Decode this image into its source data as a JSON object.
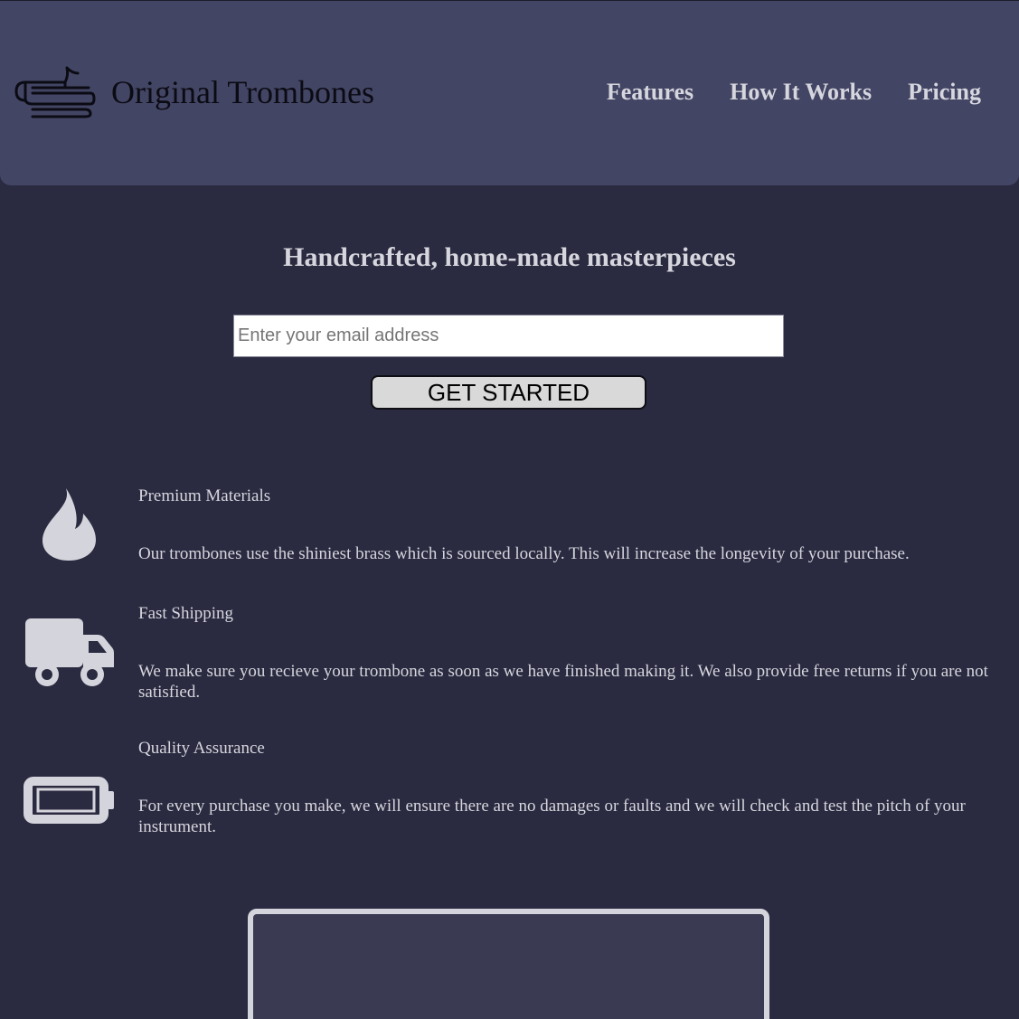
{
  "header": {
    "brand": "Original Trombones",
    "logo_icon": "trombone-icon",
    "nav": [
      {
        "label": "Features"
      },
      {
        "label": "How It Works"
      },
      {
        "label": "Pricing"
      }
    ]
  },
  "hero": {
    "title": "Handcrafted, home-made masterpieces",
    "email_placeholder": "Enter your email address",
    "email_value": "",
    "button_label": "GET STARTED"
  },
  "features": [
    {
      "icon": "fire-icon",
      "title": "Premium Materials",
      "description": "Our trombones use the shiniest brass which is sourced locally. This will increase the longevity of your purchase."
    },
    {
      "icon": "truck-icon",
      "title": "Fast Shipping",
      "description": "We make sure you recieve your trombone as soon as we have finished making it. We also provide free returns if you are not satisfied."
    },
    {
      "icon": "battery-icon",
      "title": "Quality Assurance",
      "description": "For every purchase you make, we will ensure there are no damages or faults and we will check and test the pitch of your instrument."
    }
  ],
  "colors": {
    "header_bg": "#434564",
    "page_bg": "#2a2a40",
    "text": "#d6d6de",
    "icon": "#d4d4dc"
  }
}
